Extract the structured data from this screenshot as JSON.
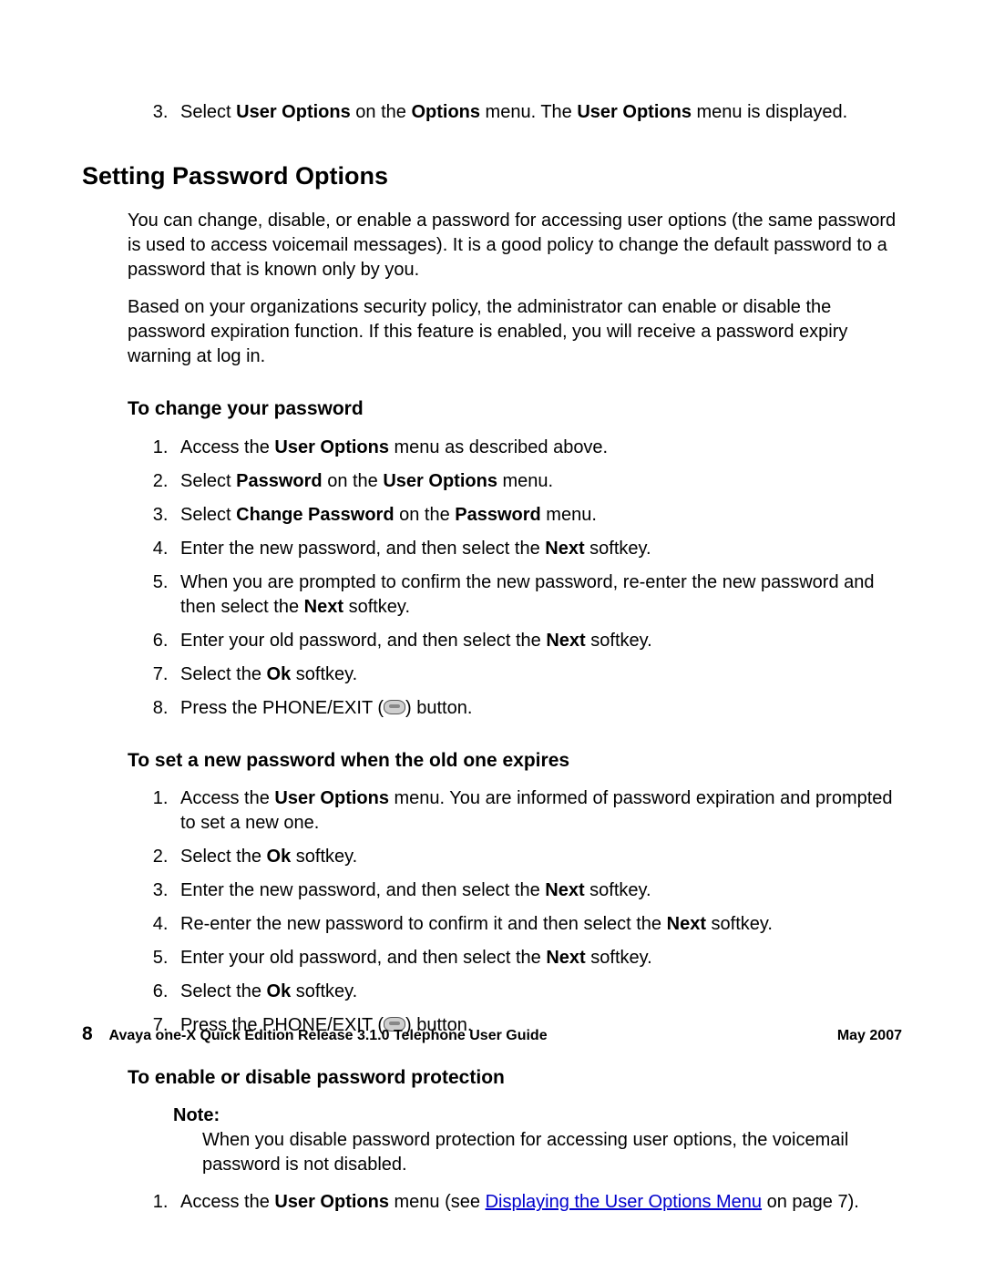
{
  "intro_step": {
    "num": "3.",
    "parts": [
      "Select ",
      "User Options",
      " on the ",
      "Options",
      " menu. The ",
      "User Options",
      " menu is displayed."
    ]
  },
  "section_heading": "Setting Password Options",
  "para1": "You can change, disable, or enable a password for accessing user options (the same password is used to access voicemail messages). It is a good policy to change the default password to a password that is known only by you.",
  "para2": "Based on your organizations security policy, the administrator can enable or disable the password expiration function. If this feature is enabled, you will receive a password expiry warning at log in.",
  "change_pw_heading": "To change your password",
  "change_pw_steps": [
    {
      "parts": [
        "Access the ",
        "User Options",
        " menu as described above."
      ]
    },
    {
      "parts": [
        "Select ",
        "Password",
        " on the ",
        "User Options",
        " menu."
      ]
    },
    {
      "parts": [
        "Select ",
        "Change Password",
        " on the ",
        "Password",
        " menu."
      ]
    },
    {
      "parts": [
        "Enter the new password, and then select the ",
        "Next",
        " softkey."
      ]
    },
    {
      "parts": [
        "When you are prompted to confirm the new password, re-enter the new password and then select the ",
        "Next",
        " softkey."
      ]
    },
    {
      "parts": [
        "Enter your old password, and then select the ",
        "Next",
        " softkey."
      ]
    },
    {
      "parts": [
        "Select the ",
        "Ok",
        " softkey."
      ]
    },
    {
      "phone": true,
      "pre": "Press the PHONE/EXIT (",
      "post": ") button."
    }
  ],
  "expire_heading": "To set a new password when the old one expires",
  "expire_steps": [
    {
      "parts": [
        "Access the ",
        "User Options",
        " menu. You are informed of password expiration and prompted to set a new one."
      ]
    },
    {
      "parts": [
        "Select the ",
        "Ok",
        " softkey."
      ]
    },
    {
      "parts": [
        "Enter the new password, and then select the ",
        "Next",
        " softkey."
      ]
    },
    {
      "parts": [
        "Re-enter the new password to confirm it and then select the ",
        "Next",
        " softkey."
      ]
    },
    {
      "parts": [
        "Enter your old password, and then select the ",
        "Next",
        " softkey."
      ]
    },
    {
      "parts": [
        "Select the ",
        "Ok",
        " softkey."
      ]
    },
    {
      "phone": true,
      "pre": "Press the PHONE/EXIT (",
      "post": ") button."
    }
  ],
  "protect_heading": "To enable or disable password protection",
  "note_label": "Note:",
  "note_body": "When you disable password protection for accessing user options, the voicemail password is not disabled.",
  "protect_step1": {
    "pre": "Access the ",
    "bold": "User Options",
    "mid": " menu (see ",
    "link": "Displaying the User Options Menu",
    "post": " on page 7)."
  },
  "footer": {
    "page_num": "8",
    "title": "Avaya one-X Quick Edition Release 3.1.0 Telephone User Guide",
    "date": "May 2007"
  }
}
